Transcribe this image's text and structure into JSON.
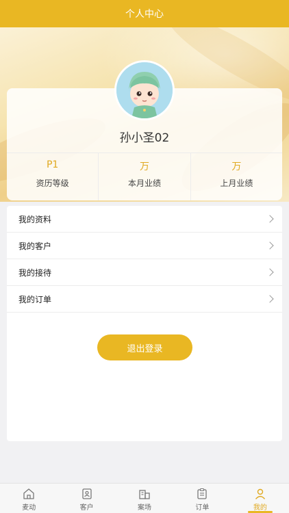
{
  "header": {
    "title": "个人中心"
  },
  "profile": {
    "username": "孙小圣02",
    "stats": [
      {
        "value": "P1",
        "label": "资历等级"
      },
      {
        "value": "万",
        "label": "本月业绩"
      },
      {
        "value": "万",
        "label": "上月业绩"
      }
    ]
  },
  "menu": {
    "items": [
      {
        "label": "我的资料"
      },
      {
        "label": "我的客户"
      },
      {
        "label": "我的接待"
      },
      {
        "label": "我的订单"
      }
    ],
    "logout_label": "退出登录"
  },
  "tabbar": {
    "tabs": [
      {
        "label": "麦动",
        "icon": "home-icon"
      },
      {
        "label": "客户",
        "icon": "contact-card-icon"
      },
      {
        "label": "案场",
        "icon": "building-icon"
      },
      {
        "label": "订单",
        "icon": "clipboard-icon"
      },
      {
        "label": "我的",
        "icon": "user-icon"
      }
    ],
    "active_index": 4
  },
  "colors": {
    "accent": "#e9b723",
    "background": "#f1f1f3"
  }
}
